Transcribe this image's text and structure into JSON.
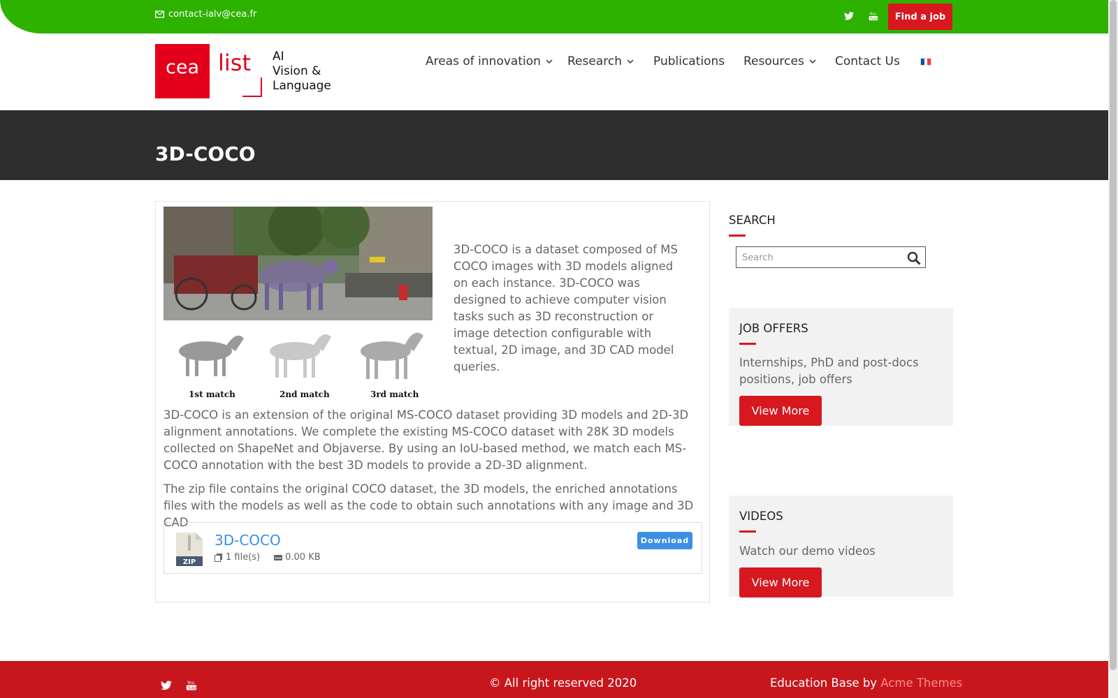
{
  "topbar": {
    "email": "contact-ialv@cea.fr",
    "find_job": "Find a job"
  },
  "logo": {
    "cea": "cea",
    "list": "list",
    "line1": "AI",
    "line2": "Vision &",
    "line3": "Language"
  },
  "nav": {
    "items": [
      {
        "label": "Areas of innovation"
      },
      {
        "label": "Research"
      },
      {
        "label": "Publications"
      },
      {
        "label": "Resources"
      },
      {
        "label": "Contact Us"
      }
    ]
  },
  "page": {
    "title": "3D-COCO"
  },
  "content": {
    "figure_captions": [
      "1st match",
      "2nd match",
      "3rd match"
    ],
    "intro": "3D-COCO is a dataset composed of MS COCO images with 3D models aligned on each instance. 3D-COCO was designed to achieve computer vision tasks such as 3D reconstruction or image detection configurable with textual, 2D image, and 3D CAD model queries.",
    "para1": "3D-COCO is an extension of the original MS-COCO dataset providing 3D models and 2D-3D alignment annotations. We complete the existing MS-COCO dataset with 28K 3D models collected on ShapeNet and Objaverse. By using an IoU-based method, we match each MS-COCO annotation with the best 3D models to provide a 2D-3D alignment.",
    "para2": "The zip file contains the original COCO dataset, the 3D models, the enriched annotations files with the models as well as the code to obtain such annotations with any image and 3D CAD",
    "download": {
      "icon_label": "ZIP",
      "title": "3D-COCO",
      "files": "1 file(s)",
      "size": "0.00 KB",
      "button": "Download"
    }
  },
  "sidebar": {
    "search_heading": "SEARCH",
    "search_placeholder": "Search",
    "jobs_heading": "JOB OFFERS",
    "jobs_text": "Internships, PhD and post-docs positions, job offers",
    "jobs_button": "View More",
    "videos_heading": "VIDEOS",
    "videos_text": "Watch our demo videos",
    "videos_button": "View More"
  },
  "footer": {
    "copyright": "© All right reserved 2020",
    "credit_prefix": "Education Base by ",
    "credit_theme": "Acme Themes"
  },
  "colors": {
    "topbar_green": "#2db200",
    "brand_red": "#d7181f",
    "link_blue": "#3d8fe4",
    "band_dark": "#2e2e2e"
  }
}
